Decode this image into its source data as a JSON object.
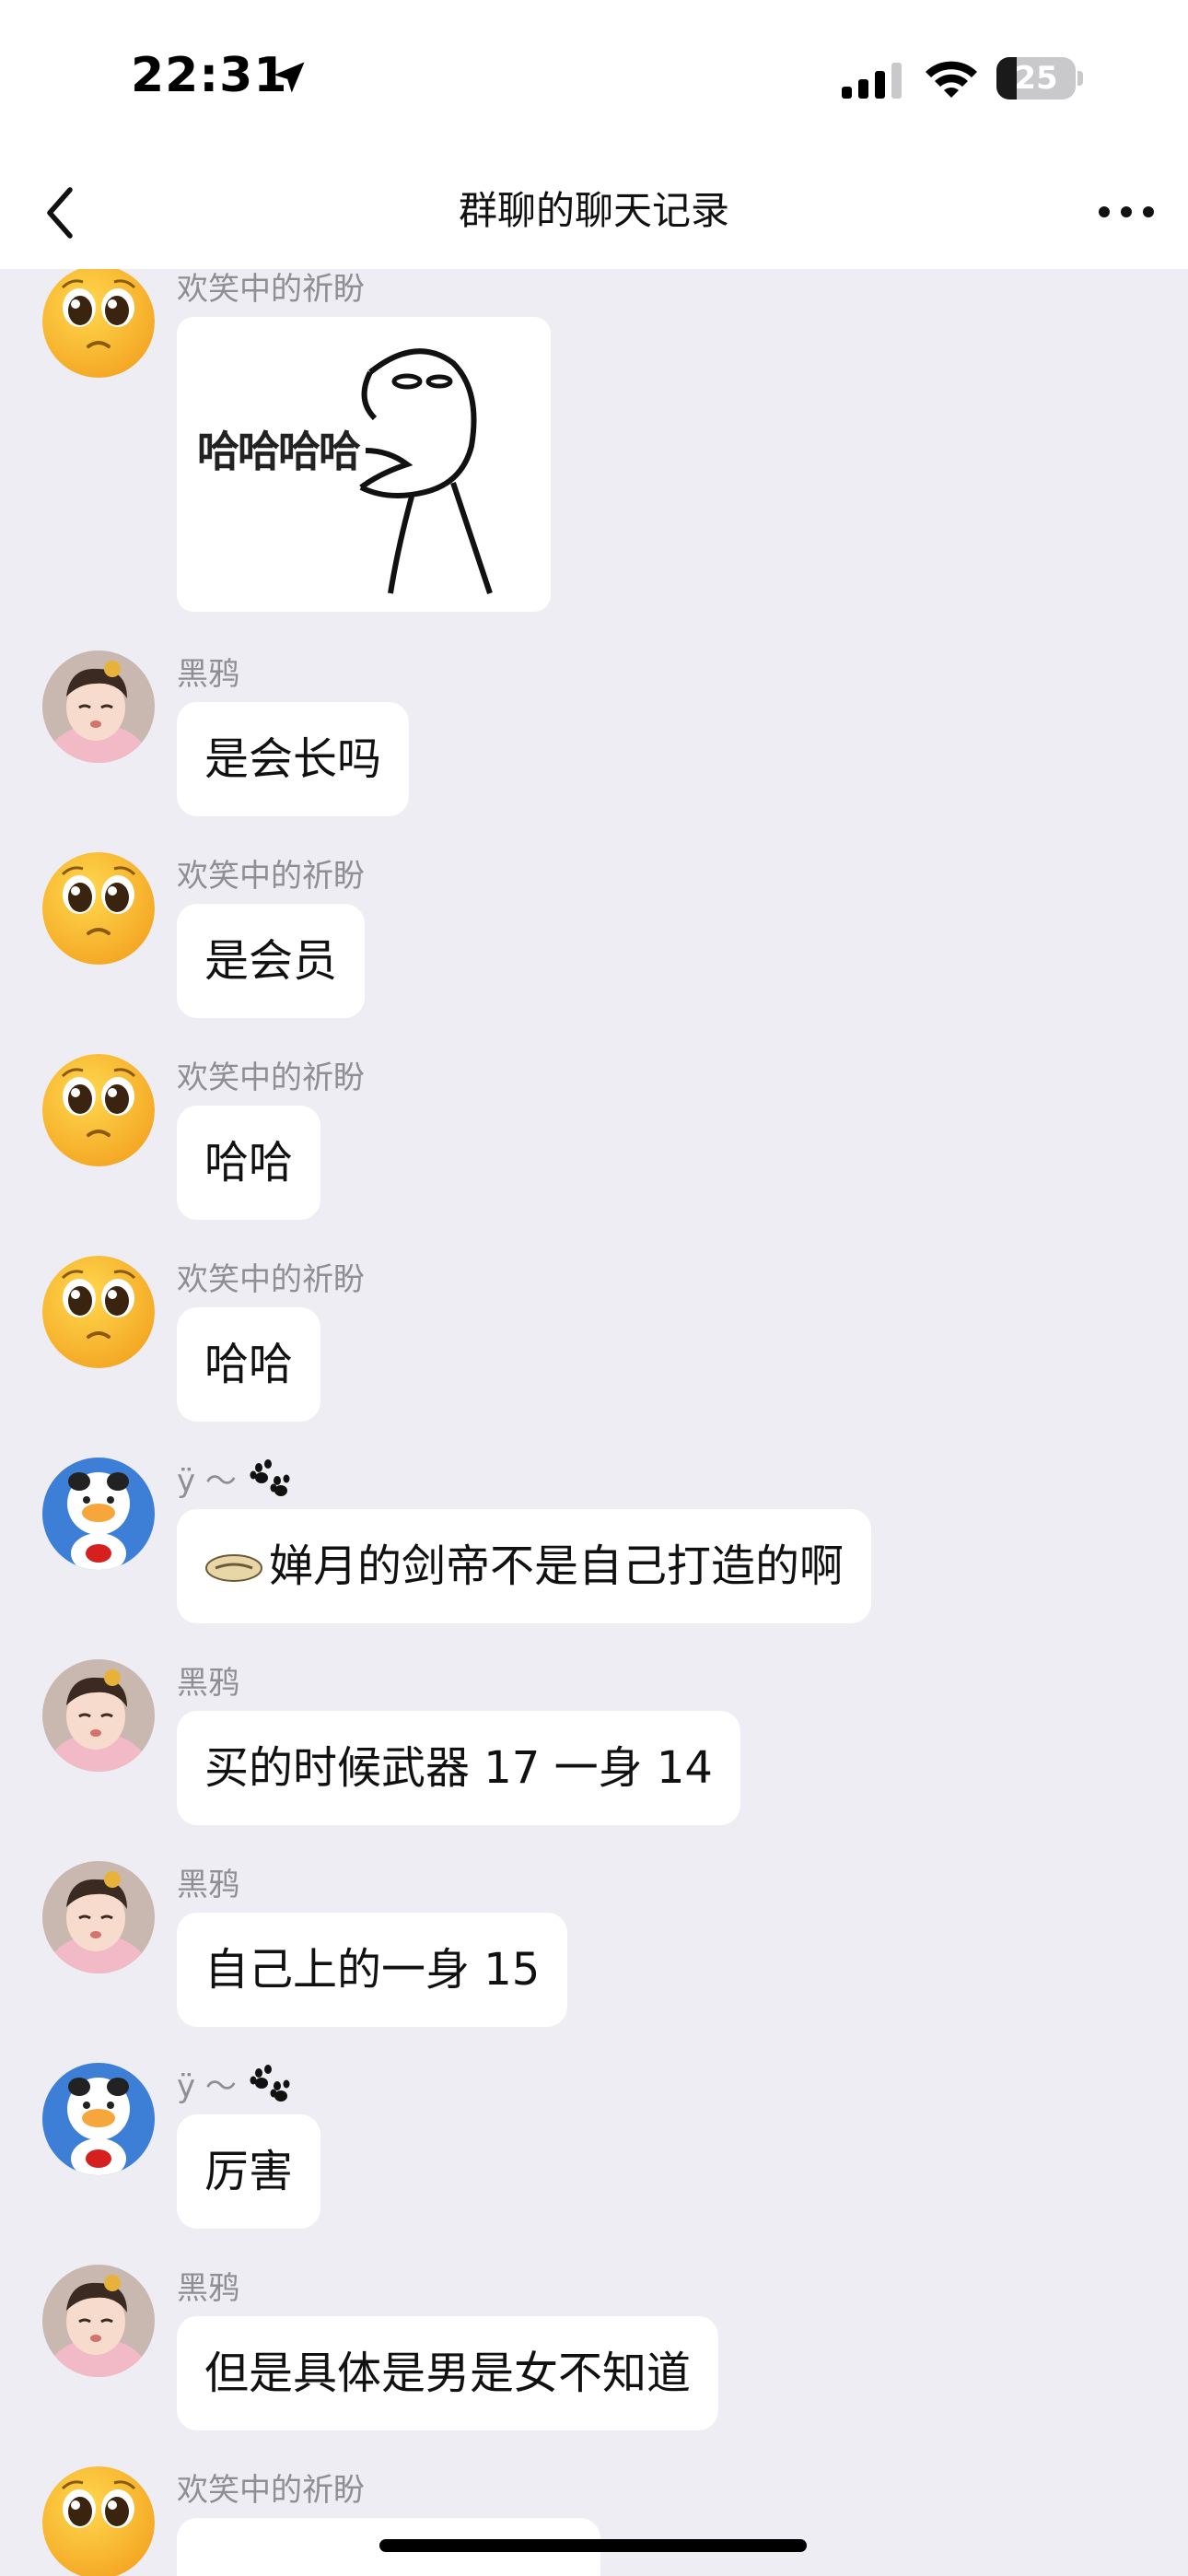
{
  "status_bar": {
    "time": "22:31",
    "battery_level": "25",
    "battery_fraction": 0.25
  },
  "nav": {
    "title": "群聊的聊天记录",
    "back_icon": "chevron-left-icon",
    "more_icon": "ellipsis-icon"
  },
  "messages": [
    {
      "sender": "欢笑中的祈盼",
      "avatar": "pleading-face-emoji",
      "type": "sticker",
      "sticker_text": "哈哈哈哈"
    },
    {
      "sender": "黑鸦",
      "avatar": "baby-photo",
      "type": "text",
      "text": "是会长吗"
    },
    {
      "sender": "欢笑中的祈盼",
      "avatar": "pleading-face-emoji",
      "type": "text",
      "text": "是会员"
    },
    {
      "sender": "欢笑中的祈盼",
      "avatar": "pleading-face-emoji",
      "type": "text",
      "text": "哈哈"
    },
    {
      "sender": "欢笑中的祈盼",
      "avatar": "pleading-face-emoji",
      "type": "text",
      "text": "哈哈"
    },
    {
      "sender": "ÿ ～",
      "avatar": "duck-plush-photo",
      "type": "text",
      "text": "婵月的剑帝不是自己打造的啊",
      "sender_icon": "paw-prints-icon",
      "leading_icon": "emoji-icon"
    },
    {
      "sender": "黑鸦",
      "avatar": "baby-photo",
      "type": "text",
      "text": "买的时候武器 17 一身 14"
    },
    {
      "sender": "黑鸦",
      "avatar": "baby-photo",
      "type": "text",
      "text": "自己上的一身 15"
    },
    {
      "sender": "ÿ ～",
      "avatar": "duck-plush-photo",
      "type": "text",
      "text": "厉害",
      "sender_icon": "paw-prints-icon"
    },
    {
      "sender": "黑鸦",
      "avatar": "baby-photo",
      "type": "text",
      "text": "但是具体是男是女不知道"
    },
    {
      "sender": "欢笑中的祈盼",
      "avatar": "pleading-face-emoji",
      "type": "text",
      "text": ""
    }
  ]
}
